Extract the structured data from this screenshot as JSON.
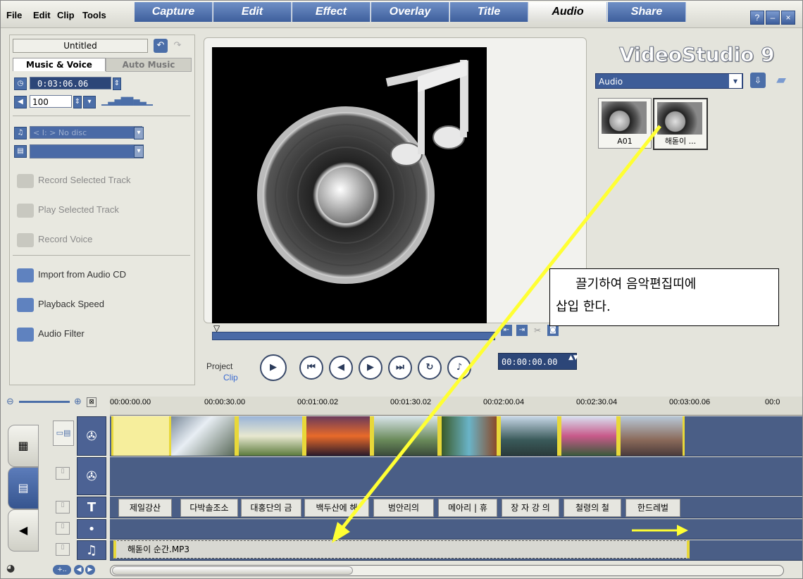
{
  "menu": {
    "file": "File",
    "edit": "Edit",
    "clip": "Clip",
    "tools": "Tools"
  },
  "tabs": [
    "Capture",
    "Edit",
    "Effect",
    "Overlay",
    "Title",
    "Audio",
    "Share"
  ],
  "active_tab": "Audio",
  "window_buttons": {
    "help": "?",
    "minimize": "–",
    "close": "×"
  },
  "project": {
    "name": "Untitled"
  },
  "panel": {
    "subtabs": [
      "Music & Voice",
      "Auto Music"
    ],
    "duration": "0:03:06.06",
    "volume": "100",
    "cd_drive": "< I: > No disc",
    "actions": {
      "record_selected": "Record Selected Track",
      "play_selected": "Play Selected Track",
      "record_voice": "Record Voice",
      "import_cd": "Import from Audio CD",
      "playback_speed": "Playback Speed",
      "audio_filter": "Audio Filter"
    }
  },
  "preview": {
    "project_label": "Project",
    "clip_label": "Clip",
    "timecode": "00:00:00.00"
  },
  "library": {
    "logo": "VideoStudio 9",
    "category": "Audio",
    "items": [
      {
        "label": "A01"
      },
      {
        "label": "해돋이 ..."
      }
    ]
  },
  "annotation": {
    "line1": "끌기하여  음악편집띠에",
    "line2": "삽입 한다."
  },
  "timeline": {
    "ruler": [
      "00:00:00.00",
      "00:00:30.00",
      "00:01:00.02",
      "00:01:30.02",
      "00:02:00.04",
      "00:02:30.04",
      "00:03:00.06",
      "00:0"
    ],
    "titles": [
      "제일강산",
      "다박솔조소",
      "대홍단의 금",
      "백두산에 해",
      "범안리의",
      "메아리 | 휴",
      "장 자 강 의",
      "철령의 철",
      "한드레벌"
    ],
    "audio_clip": "해돋이 순간.MP3"
  },
  "colors": {
    "accent_blue": "#3e5f9c",
    "clip_yellow": "#e8d83a",
    "arrow_yellow": "#ffff33"
  }
}
